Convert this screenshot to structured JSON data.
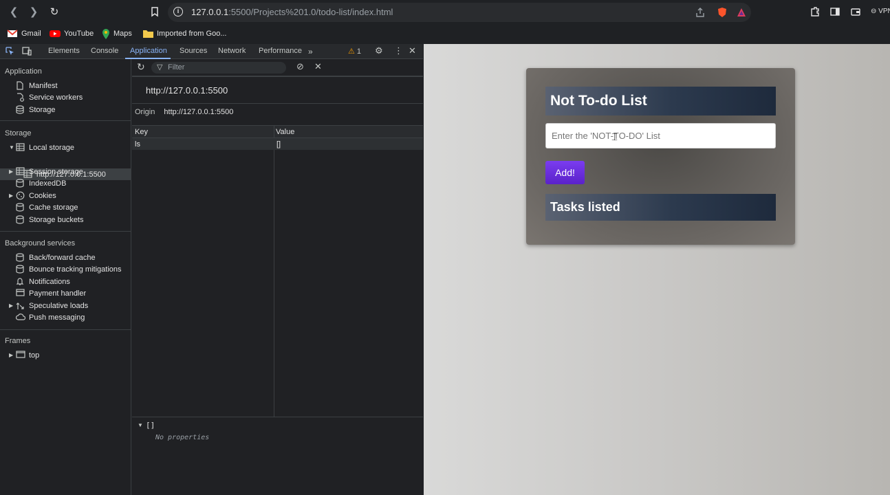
{
  "browser": {
    "url_host": "127.0.0.1",
    "url_rest": ":5500/Projects%201.0/todo-list/index.html",
    "vpn_label": "VPN"
  },
  "bookmarks": [
    {
      "label": "Gmail",
      "icon": "gmail-icon"
    },
    {
      "label": "YouTube",
      "icon": "youtube-icon"
    },
    {
      "label": "Maps",
      "icon": "maps-icon"
    },
    {
      "label": "Imported from Goo...",
      "icon": "folder-icon"
    }
  ],
  "devtools": {
    "tabs": [
      "Elements",
      "Console",
      "Application",
      "Sources",
      "Network",
      "Performance"
    ],
    "active_tab": "Application",
    "warning_count": "1",
    "filter_placeholder": "Filter",
    "sidebar": {
      "application_heading": "Application",
      "application_items": [
        "Manifest",
        "Service workers",
        "Storage"
      ],
      "storage_heading": "Storage",
      "local_storage": "Local storage",
      "local_storage_child": "http://127.0.0.1:5500",
      "storage_items": [
        "Session storage",
        "IndexedDB",
        "Cookies",
        "Cache storage",
        "Storage buckets"
      ],
      "background_heading": "Background services",
      "background_items": [
        "Back/forward cache",
        "Bounce tracking mitigations",
        "Notifications",
        "Payment handler",
        "Speculative loads",
        "Push messaging"
      ],
      "frames_heading": "Frames",
      "frames_item": "top"
    },
    "main": {
      "origin_title": "http://127.0.0.1:5500",
      "origin_label": "Origin",
      "origin_value": "http://127.0.0.1:5500",
      "columns": [
        "Key",
        "Value"
      ],
      "rows": [
        {
          "key": "ls",
          "value": "[]"
        }
      ],
      "preview_label": "[]",
      "preview_empty": "No properties"
    }
  },
  "page": {
    "title": "Not To-do List",
    "input_placeholder": "Enter the 'NOT-TO-DO' List",
    "add_button": "Add!",
    "tasks_heading": "Tasks listed"
  }
}
